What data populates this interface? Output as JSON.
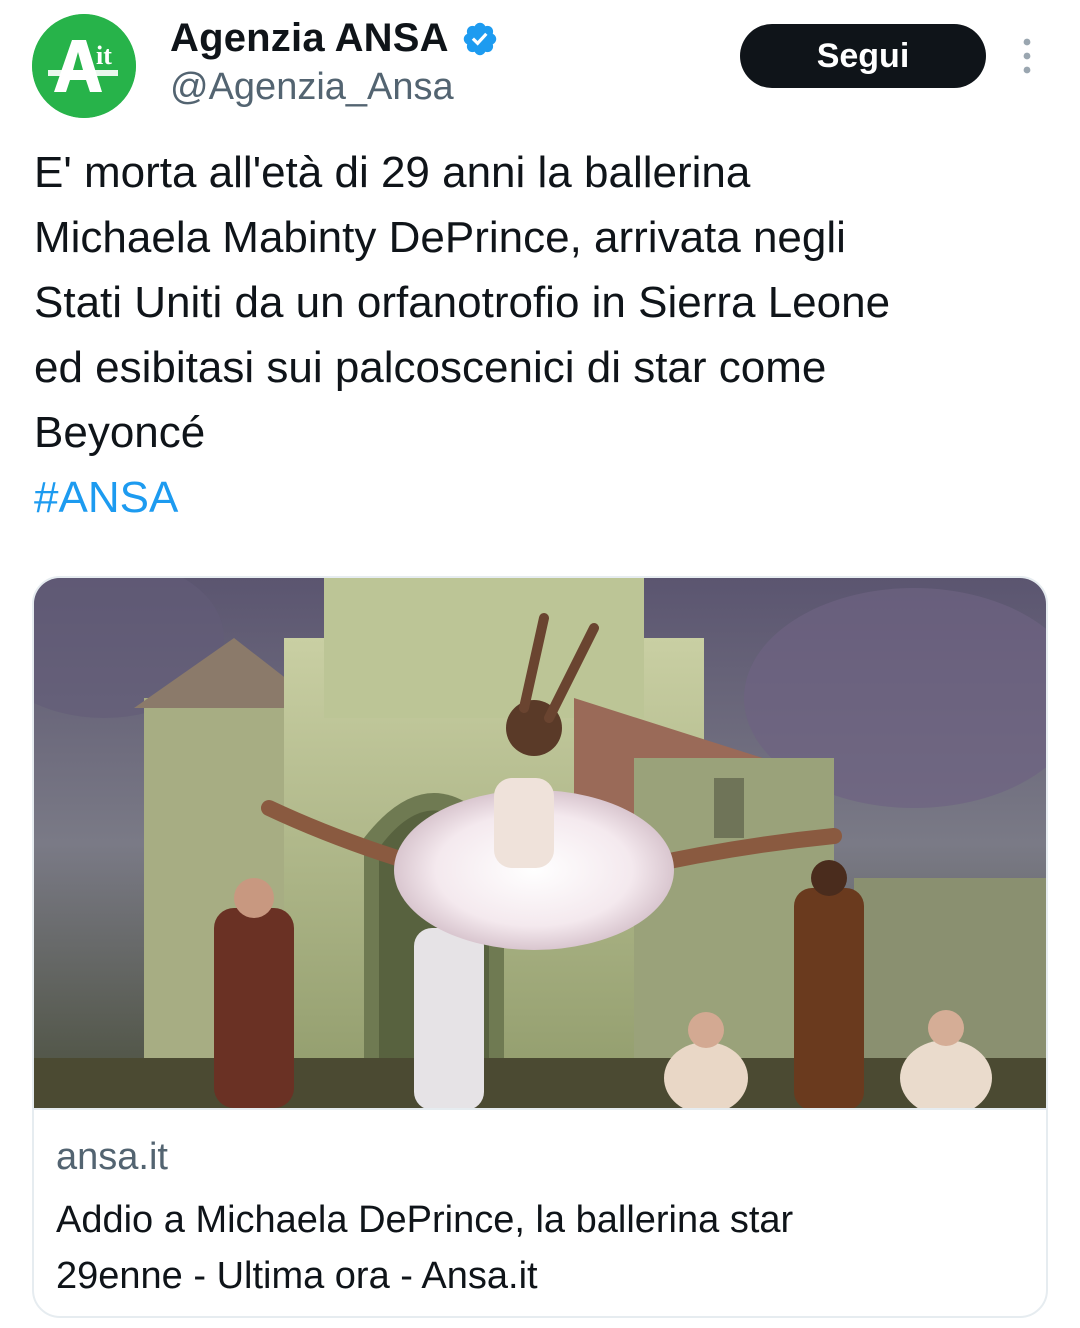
{
  "account": {
    "avatar_text": "Ait",
    "display_name": "Agenzia ANSA",
    "handle": "@Agenzia_Ansa",
    "verified": true
  },
  "actions": {
    "follow_label": "Segui",
    "more_icon": "more-vertical-icon"
  },
  "tweet": {
    "lines": [
      "E' morta all'età di 29 anni la ballerina",
      "Michaela Mabinty DePrince, arrivata negli",
      "Stati Uniti da un orfanotrofio in Sierra Leone",
      "ed esibitasi sui palcoscenici di star come",
      "Beyoncé"
    ],
    "hashtag": "#ANSA"
  },
  "link_card": {
    "domain": "ansa.it",
    "title_lines": [
      "Addio a Michaela DePrince, la ballerina star",
      "29enne - Ultima ora - Ansa.it"
    ]
  },
  "colors": {
    "accent": "#1d9bf0",
    "brand_green": "#27b34a",
    "text": "#0f1419",
    "muted": "#536471",
    "button_bg": "#0f1419"
  }
}
